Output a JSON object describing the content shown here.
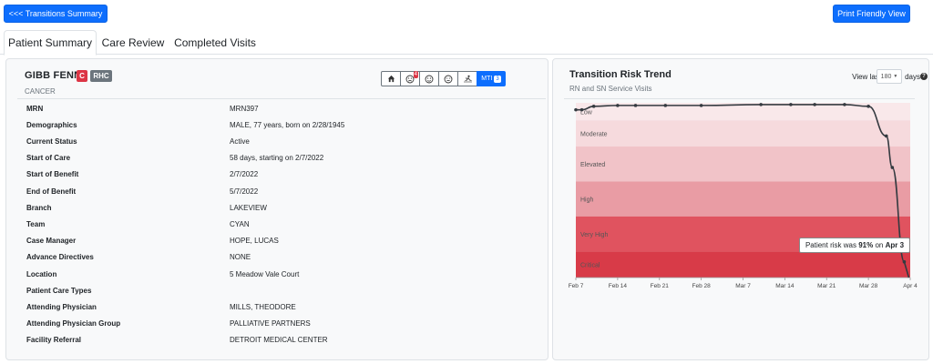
{
  "top": {
    "back_label": "<<< Transitions Summary",
    "print_label": "Print Friendly View"
  },
  "tabs": [
    {
      "label": "Patient Summary",
      "active": true
    },
    {
      "label": "Care Review",
      "active": false
    },
    {
      "label": "Completed Visits",
      "active": false
    }
  ],
  "patient": {
    "name": "GIBB FENN",
    "badge_c": "C",
    "badge_rhc": "RHC",
    "diagnosis": "CANCER",
    "header_buttons": [
      {
        "icon": "home-icon",
        "badge": ""
      },
      {
        "icon": "sad-face-icon",
        "badge": "4"
      },
      {
        "icon": "neutral-face-icon",
        "badge": ""
      },
      {
        "icon": "happy-face-icon",
        "badge": ""
      },
      {
        "icon": "walking-icon",
        "badge": ""
      }
    ],
    "mti_label": "MTI",
    "mti_count": "3",
    "fields": [
      {
        "label": "MRN",
        "value": "MRN397"
      },
      {
        "label": "Demographics",
        "value": "MALE, 77 years, born on 2/28/1945"
      },
      {
        "label": "Current Status",
        "value": "Active"
      },
      {
        "label": "Start of Care",
        "value": "58 days, starting on 2/7/2022"
      },
      {
        "label": "Start of Benefit",
        "value": "2/7/2022"
      },
      {
        "label": "End of Benefit",
        "value": "5/7/2022"
      },
      {
        "label": "Branch",
        "value": "LAKEVIEW"
      },
      {
        "label": "Team",
        "value": "CYAN"
      },
      {
        "label": "Case Manager",
        "value": "HOPE, LUCAS"
      },
      {
        "label": "Advance Directives",
        "value": "NONE"
      },
      {
        "label": "Location",
        "value": "5 Meadow Vale Court"
      },
      {
        "label": "Patient Care Types",
        "value": ""
      },
      {
        "label": "Attending Physician",
        "value": "MILLS, THEODORE"
      },
      {
        "label": "Attending Physician Group",
        "value": "PALLIATIVE PARTNERS"
      },
      {
        "label": "Facility Referral",
        "value": "DETROIT MEDICAL CENTER"
      }
    ]
  },
  "risk": {
    "title": "Transition Risk Trend",
    "subtitle": "RN and SN Service Visits",
    "view_last_label": "View last",
    "view_last_value": "180",
    "days_label": "days",
    "tooltip_prefix": "Patient risk was",
    "tooltip_value": "91%",
    "tooltip_mid": "on",
    "tooltip_date": "Apr 3"
  },
  "chart_data": {
    "type": "line",
    "title": "Transition Risk Trend",
    "subtitle": "RN and SN Service Visits",
    "y_unit": "percent",
    "ylim": [
      0,
      100
    ],
    "bands": [
      {
        "name": "Low",
        "from": 0,
        "to": 10,
        "color": "#f9e8ea"
      },
      {
        "name": "Moderate",
        "from": 10,
        "to": 25,
        "color": "#f6dadd"
      },
      {
        "name": "Elevated",
        "from": 25,
        "to": 45,
        "color": "#f1c3c8"
      },
      {
        "name": "High",
        "from": 45,
        "to": 65,
        "color": "#e99ca4"
      },
      {
        "name": "Very High",
        "from": 65,
        "to": 85,
        "color": "#e0535f"
      },
      {
        "name": "Critical",
        "from": 85,
        "to": 100,
        "color": "#d83b48"
      }
    ],
    "x_ticks": [
      "Feb 7",
      "Feb 14",
      "Feb 21",
      "Feb 28",
      "Mar 7",
      "Mar 14",
      "Mar 21",
      "Mar 28",
      "Apr 4"
    ],
    "x_start": "2022-02-07",
    "x_end": "2022-04-04",
    "points": [
      {
        "x": "2022-02-07",
        "y": 4
      },
      {
        "x": "2022-02-08",
        "y": 4
      },
      {
        "x": "2022-02-10",
        "y": 2
      },
      {
        "x": "2022-02-14",
        "y": 1.5
      },
      {
        "x": "2022-02-17",
        "y": 1.5
      },
      {
        "x": "2022-02-22",
        "y": 1.5
      },
      {
        "x": "2022-02-28",
        "y": 1.5
      },
      {
        "x": "2022-03-10",
        "y": 1
      },
      {
        "x": "2022-03-15",
        "y": 1
      },
      {
        "x": "2022-03-19",
        "y": 1
      },
      {
        "x": "2022-03-24",
        "y": 1
      },
      {
        "x": "2022-03-28",
        "y": 2
      },
      {
        "x": "2022-03-31",
        "y": 19
      },
      {
        "x": "2022-04-01",
        "y": 37
      },
      {
        "x": "2022-04-03",
        "y": 91
      }
    ],
    "line_color": "#343a40",
    "grid": false
  }
}
